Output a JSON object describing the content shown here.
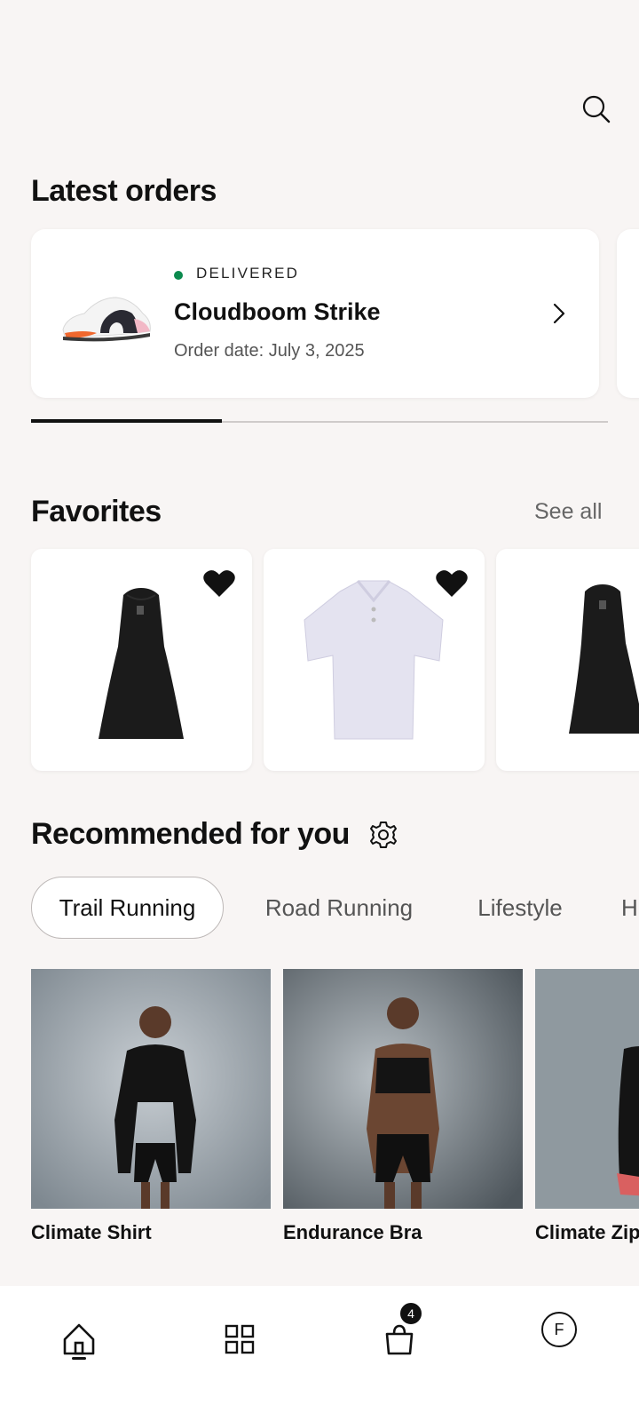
{
  "header": {
    "search_icon": "search-icon"
  },
  "latest_orders": {
    "title": "Latest orders",
    "orders": [
      {
        "status": "DELIVERED",
        "status_color": "#0b8a4e",
        "product_name": "Cloudboom Strike",
        "order_date": "Order date: July 3, 2025"
      }
    ],
    "carousel_progress_fraction": 0.33
  },
  "favorites": {
    "title": "Favorites",
    "see_all_label": "See all",
    "items": [
      {
        "product": "black-dress",
        "favorited": true
      },
      {
        "product": "white-polo",
        "favorited": true
      },
      {
        "product": "black-dress",
        "favorited": true
      }
    ]
  },
  "recommended": {
    "title": "Recommended for you",
    "chips": [
      "Trail Running",
      "Road Running",
      "Lifestyle",
      "H"
    ],
    "active_chip": "Trail Running",
    "products": [
      {
        "name": "Climate Shirt"
      },
      {
        "name": "Endurance Bra"
      },
      {
        "name": "Climate Zip"
      }
    ]
  },
  "bottom_nav": {
    "items": [
      "home-icon",
      "grid-icon",
      "cart-icon",
      "profile-icon"
    ],
    "active": "home-icon",
    "cart_count": "4",
    "avatar_initial": "F"
  },
  "colors": {
    "background": "#f8f5f4",
    "accent": "#111111"
  }
}
